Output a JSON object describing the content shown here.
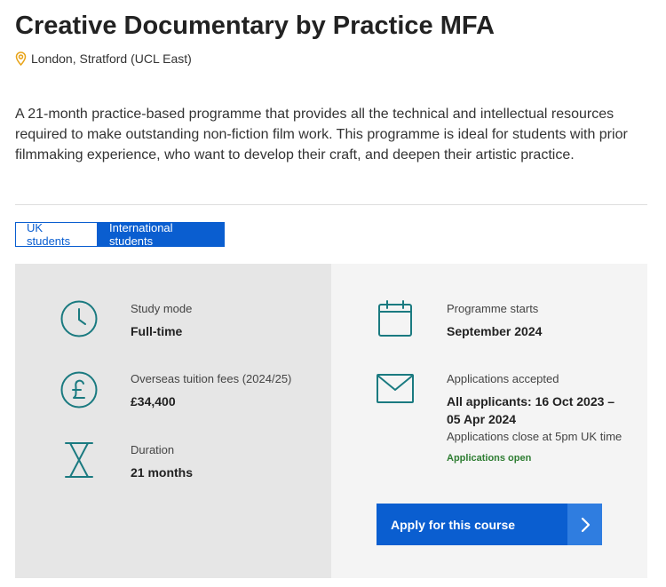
{
  "page": {
    "title": "Creative Documentary by Practice MFA",
    "location": "London, Stratford (UCL East)",
    "description": "A 21-month practice-based programme that provides all the technical and intellectual resources required to make outstanding non-fiction film work. This programme is ideal for students with prior filmmaking experience, who want to develop their craft, and deepen their artistic practice."
  },
  "tabs": [
    {
      "label": "UK students",
      "active": false
    },
    {
      "label": "International students",
      "active": true
    }
  ],
  "facts": {
    "study_mode": {
      "label": "Study mode",
      "value": "Full-time"
    },
    "fees": {
      "label": "Overseas tuition fees (2024/25)",
      "value": "£34,400"
    },
    "duration": {
      "label": "Duration",
      "value": "21 months"
    },
    "starts": {
      "label": "Programme starts",
      "value": "September 2024"
    },
    "applications": {
      "label": "Applications accepted",
      "value_line1": "All applicants: 16 Oct 2023 –",
      "value_line2": "05 Apr 2024",
      "note": "Applications close at 5pm UK time",
      "status": "Applications open"
    }
  },
  "apply_button": {
    "label": "Apply for this course"
  },
  "colors": {
    "accent": "#0a5ed0",
    "icon": "#1a7a80",
    "status_open": "#2e7d32",
    "location_pin": "#e8a317"
  },
  "icons": {
    "location": "location-pin-icon",
    "study_mode": "clock-icon",
    "fees": "pound-icon",
    "duration": "hourglass-icon",
    "starts": "calendar-icon",
    "applications": "envelope-icon",
    "apply": "chevron-right-icon"
  }
}
